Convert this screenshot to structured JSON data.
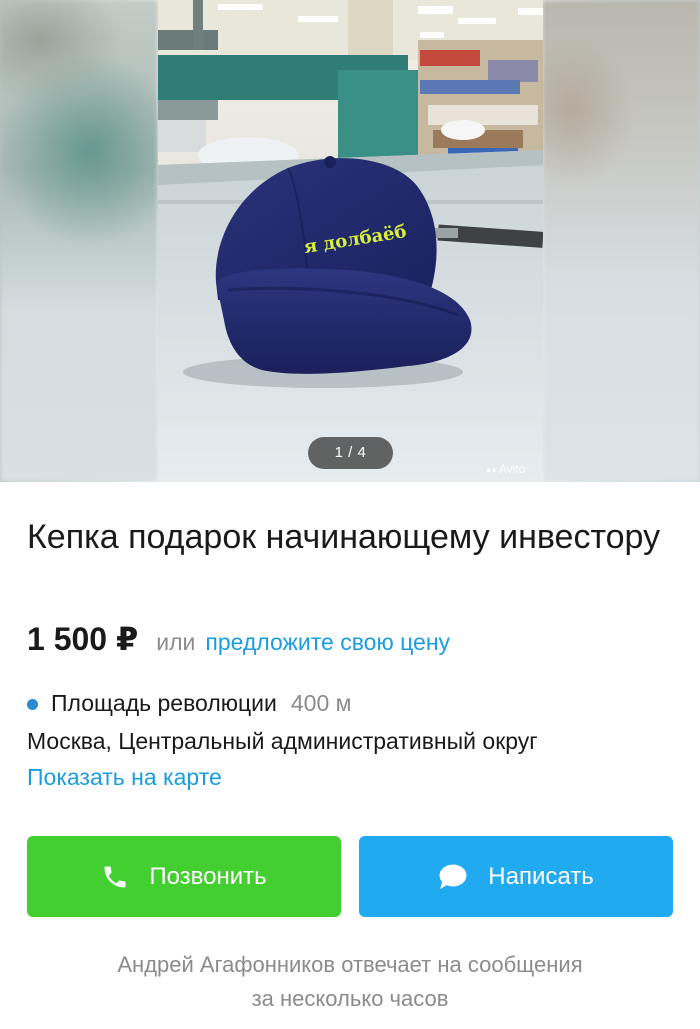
{
  "gallery": {
    "counter": "1 / 4",
    "watermark": "Avito",
    "cap_text": "я долбаёб"
  },
  "listing": {
    "title": "Кепка подарок начинающему инвестору",
    "price": "1 500 ₽",
    "price_or": "или",
    "price_offer_link": "предложите свою цену"
  },
  "location": {
    "metro_name": "Площадь революции",
    "metro_distance": "400 м",
    "address": "Москва, Центральный административный округ",
    "map_link": "Показать на карте"
  },
  "actions": {
    "call_label": "Позвонить",
    "write_label": "Написать"
  },
  "seller": {
    "reply_line1": "Андрей Агафонников отвечает на сообщения",
    "reply_line2": "за несколько часов"
  },
  "colors": {
    "call_button": "#42cf2f",
    "write_button": "#20aaf0",
    "link": "#1a9ee1",
    "metro_dot": "#2b8ad0",
    "cap": "#1f2868",
    "cap_text": "#d8f03a"
  },
  "icons": {
    "call": "phone-icon",
    "write": "chat-bubble-icon"
  }
}
